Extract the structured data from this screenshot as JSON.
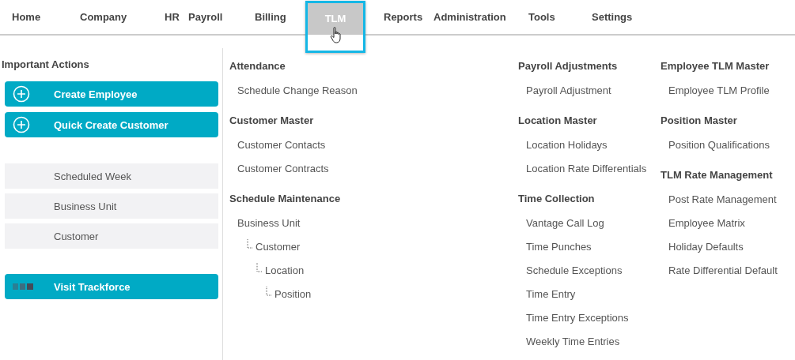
{
  "nav": [
    {
      "label": "Home",
      "selected": false
    },
    {
      "label": "Company",
      "selected": false
    },
    {
      "label": "HR",
      "selected": false
    },
    {
      "label": "Payroll",
      "selected": false
    },
    {
      "label": "Billing",
      "selected": false
    },
    {
      "label": "TLM",
      "selected": true
    },
    {
      "label": "Reports",
      "selected": false
    },
    {
      "label": "Administration",
      "selected": false
    },
    {
      "label": "Tools",
      "selected": false
    },
    {
      "label": "Settings",
      "selected": false
    }
  ],
  "important_actions": {
    "title": "Important Actions",
    "actions": [
      {
        "label": "Create Employee"
      },
      {
        "label": "Quick Create Customer"
      }
    ],
    "shortcuts": [
      {
        "label": "Scheduled Week"
      },
      {
        "label": "Business Unit"
      },
      {
        "label": "Customer"
      }
    ],
    "external_link": {
      "label": "Visit Trackforce"
    }
  },
  "menu_columns": [
    {
      "sections": [
        {
          "title": "Attendance",
          "items": [
            {
              "label": "Schedule Change Reason"
            }
          ]
        },
        {
          "title": "Customer Master",
          "items": [
            {
              "label": "Customer Contacts"
            },
            {
              "label": "Customer Contracts"
            }
          ]
        },
        {
          "title": "Schedule Maintenance",
          "items": [
            {
              "label": "Business Unit",
              "children": [
                {
                  "label": "Customer",
                  "children": [
                    {
                      "label": "Location",
                      "children": [
                        {
                          "label": "Position"
                        }
                      ]
                    }
                  ]
                }
              ]
            }
          ]
        }
      ]
    },
    {
      "sections": [
        {
          "title": "Payroll Adjustments",
          "items": [
            {
              "label": "Payroll Adjustment"
            }
          ]
        },
        {
          "title": "Location Master",
          "items": [
            {
              "label": "Location Holidays"
            },
            {
              "label": "Location Rate Differentials"
            }
          ]
        },
        {
          "title": "Time Collection",
          "items": [
            {
              "label": "Vantage Call Log"
            },
            {
              "label": "Time Punches"
            },
            {
              "label": "Schedule Exceptions"
            },
            {
              "label": "Time Entry"
            },
            {
              "label": "Time Entry Exceptions"
            },
            {
              "label": "Weekly Time Entries"
            }
          ]
        }
      ]
    },
    {
      "sections": [
        {
          "title": "Employee TLM Master",
          "items": [
            {
              "label": "Employee TLM Profile"
            }
          ]
        },
        {
          "title": "Position Master",
          "items": [
            {
              "label": "Position Qualifications"
            }
          ]
        },
        {
          "title": "TLM Rate Management",
          "items": [
            {
              "label": "Post Rate Management"
            },
            {
              "label": "Employee Matrix"
            },
            {
              "label": "Holiday Defaults"
            },
            {
              "label": "Rate Differential Default"
            }
          ]
        }
      ]
    }
  ]
}
